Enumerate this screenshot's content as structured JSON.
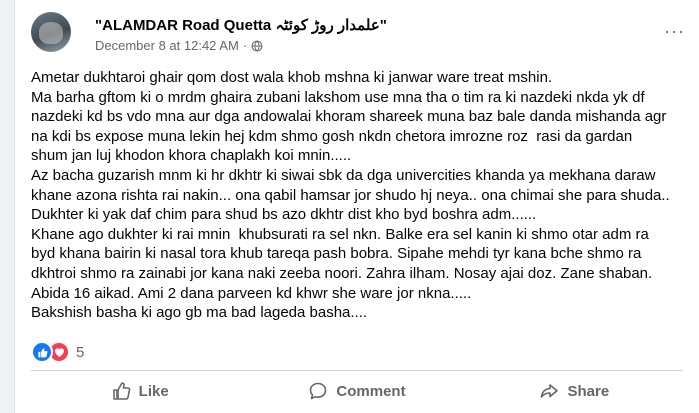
{
  "post": {
    "page_name": "\"ALAMDAR Road Quetta علمدار روڑ کوئٹہ\"",
    "timestamp": "December 8 at 12:42 AM",
    "separator": "·",
    "more_label": "···",
    "lines": [
      "Ametar dukhtaroi ghair qom dost wala khob mshna ki janwar ware treat mshin.",
      "Ma barha gftom ki o mrdm ghaira zubani lakshom use mna tha o tim ra ki nazdeki nkda yk df nazdeki kd bs vdo mna aur dga andowalai khoram shareek muna baz bale danda mishanda agr na kdi bs expose muna lekin hej kdm shmo gosh nkdn chetora imrozne roz  rasi da gardan shum jan luj khodon khora chaplakh koi mnin.....",
      "Az bacha guzarish mnm ki hr dkhtr ki siwai sbk da dga univercities khanda ya mekhana daraw khane azona rishta rai nakin... ona qabil hamsar jor shudo hj neya.. ona chimai she para shuda..",
      "Dukhter ki yak daf chim para shud bs azo dkhtr dist kho byd boshra adm......",
      "Khane ago dukhter ki rai mnin  khubsurati ra sel nkn. Balke era sel kanin ki shmo otar adm ra byd khana bairin ki nasal tora khub tareqa pash bobra. Sipahe mehdi tyr kana bche shmo ra dkhtroi shmo ra zainabi jor kana naki zeeba noori. Zahra ilham. Nosay ajai doz. Zane shaban. Abida 16 aikad. Ami 2 dana parveen kd khwr she ware jor nkna.....",
      "Bakshish basha ki ago gb ma bad lageda basha...."
    ],
    "reaction_count": "5"
  },
  "actions": {
    "like": "Like",
    "comment": "Comment",
    "share": "Share"
  },
  "colors": {
    "like_blue": "#1877f2",
    "love_red": "#f33e58",
    "secondary_text": "#65676b"
  },
  "icons": [
    "globe-icon",
    "more-options-icon",
    "like-reaction-icon",
    "love-reaction-icon",
    "like-icon",
    "comment-icon",
    "share-icon"
  ]
}
